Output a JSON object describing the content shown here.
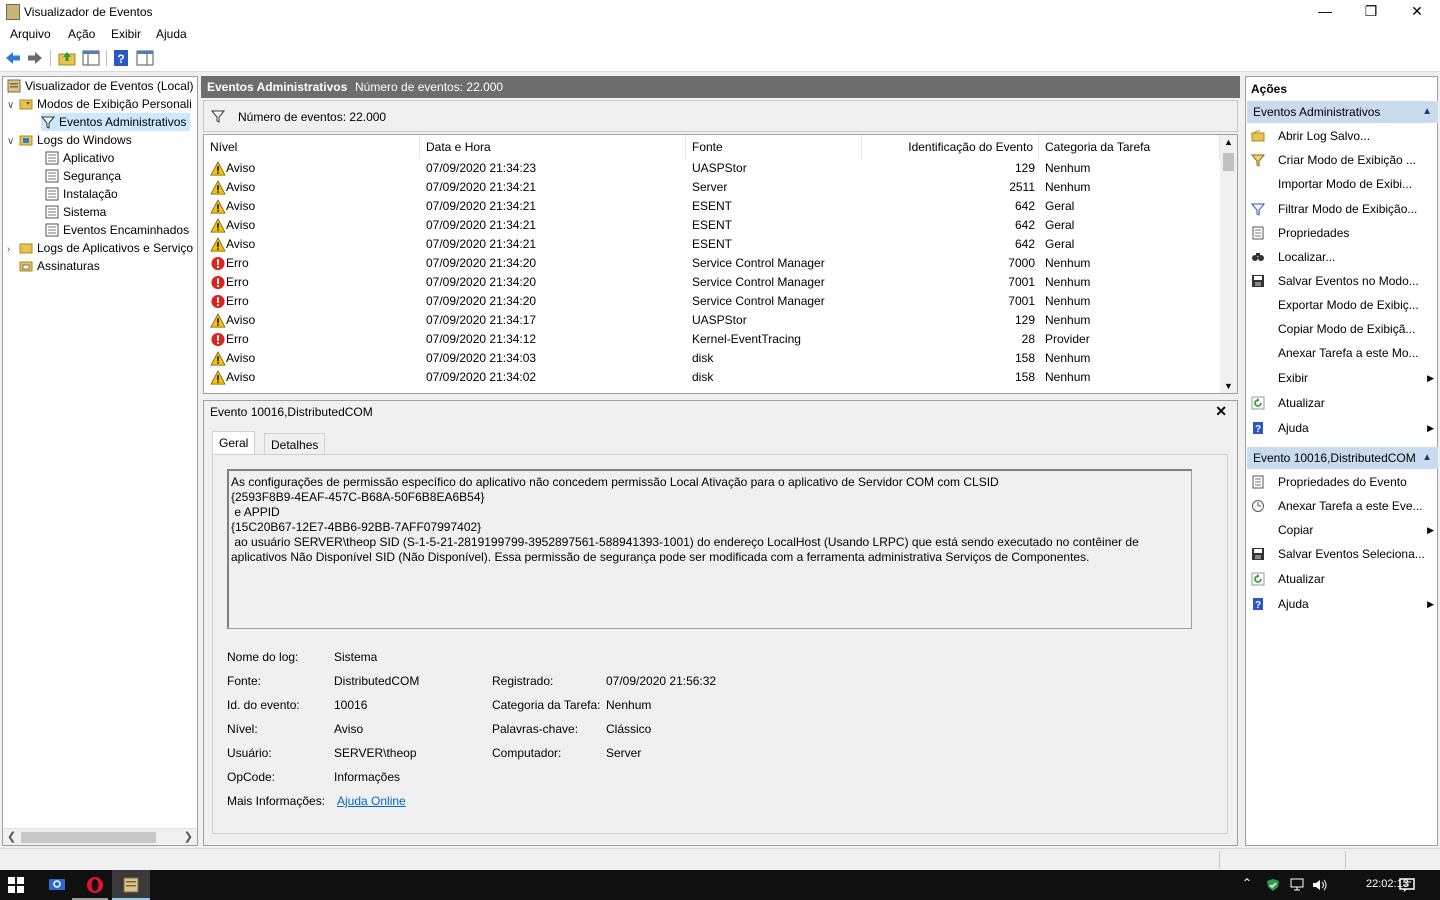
{
  "window": {
    "title": "Visualizador de Eventos"
  },
  "menu": [
    "Arquivo",
    "Ação",
    "Exibir",
    "Ajuda"
  ],
  "tree": {
    "root": "Visualizador de Eventos (Local)",
    "custom_views": "Modos de Exibição Personali",
    "admin_events": "Eventos Administrativos",
    "windows_logs": "Logs do Windows",
    "app": "Aplicativo",
    "security": "Segurança",
    "setup": "Instalação",
    "system": "Sistema",
    "forwarded": "Eventos Encaminhados",
    "app_services": "Logs de Aplicativos e Serviço",
    "subscriptions": "Assinaturas"
  },
  "center": {
    "title": "Eventos Administrativos",
    "count": "Número de eventos: 22.000",
    "filter_text": "Número de eventos: 22.000"
  },
  "columns": {
    "level": "Nível",
    "date": "Data e Hora",
    "source": "Fonte",
    "id": "Identificação do Evento",
    "category": "Categoria da Tarefa"
  },
  "events": [
    {
      "level": "Aviso",
      "type": "warning",
      "date": "07/09/2020 21:34:23",
      "source": "UASPStor",
      "id": "129",
      "category": "Nenhum"
    },
    {
      "level": "Aviso",
      "type": "warning",
      "date": "07/09/2020 21:34:21",
      "source": "Server",
      "id": "2511",
      "category": "Nenhum"
    },
    {
      "level": "Aviso",
      "type": "warning",
      "date": "07/09/2020 21:34:21",
      "source": "ESENT",
      "id": "642",
      "category": "Geral"
    },
    {
      "level": "Aviso",
      "type": "warning",
      "date": "07/09/2020 21:34:21",
      "source": "ESENT",
      "id": "642",
      "category": "Geral"
    },
    {
      "level": "Aviso",
      "type": "warning",
      "date": "07/09/2020 21:34:21",
      "source": "ESENT",
      "id": "642",
      "category": "Geral"
    },
    {
      "level": "Erro",
      "type": "error",
      "date": "07/09/2020 21:34:20",
      "source": "Service Control Manager",
      "id": "7000",
      "category": "Nenhum"
    },
    {
      "level": "Erro",
      "type": "error",
      "date": "07/09/2020 21:34:20",
      "source": "Service Control Manager",
      "id": "7001",
      "category": "Nenhum"
    },
    {
      "level": "Erro",
      "type": "error",
      "date": "07/09/2020 21:34:20",
      "source": "Service Control Manager",
      "id": "7001",
      "category": "Nenhum"
    },
    {
      "level": "Aviso",
      "type": "warning",
      "date": "07/09/2020 21:34:17",
      "source": "UASPStor",
      "id": "129",
      "category": "Nenhum"
    },
    {
      "level": "Erro",
      "type": "error",
      "date": "07/09/2020 21:34:12",
      "source": "Kernel-EventTracing",
      "id": "28",
      "category": "Provider"
    },
    {
      "level": "Aviso",
      "type": "warning",
      "date": "07/09/2020 21:34:03",
      "source": "disk",
      "id": "158",
      "category": "Nenhum"
    },
    {
      "level": "Aviso",
      "type": "warning",
      "date": "07/09/2020 21:34:02",
      "source": "disk",
      "id": "158",
      "category": "Nenhum"
    }
  ],
  "detail": {
    "title": "Evento 10016,DistributedCOM",
    "tab_general": "Geral",
    "tab_details": "Detalhes",
    "description": "As configurações de permissão específico do aplicativo não concedem permissão Local Ativação para o aplicativo de Servidor COM com CLSID\n{2593F8B9-4EAF-457C-B68A-50F6B8EA6B54}\n e APPID\n{15C20B67-12E7-4BB6-92BB-7AFF07997402}\n ao usuário SERVER\\theop SID (S-1-5-21-2819199799-3952897561-588941393-1001) do endereço LocalHost (Usando LRPC) que está sendo executado no contêiner de aplicativos Não Disponível SID (Não Disponível). Essa permissão de segurança pode ser modificada com a ferramenta administrativa Serviços de Componentes.",
    "fields": {
      "log_name_label": "Nome do log:",
      "log_name": "Sistema",
      "source_label": "Fonte:",
      "source": "DistributedCOM",
      "logged_label": "Registrado:",
      "logged": "07/09/2020 21:56:32",
      "event_id_label": "Id. do evento:",
      "event_id": "10016",
      "task_cat_label": "Categoria da Tarefa:",
      "task_cat": "Nenhum",
      "level_label": "Nível:",
      "level": "Aviso",
      "keywords_label": "Palavras-chave:",
      "keywords": "Clássico",
      "user_label": "Usuário:",
      "user": "SERVER\\theop",
      "computer_label": "Computador:",
      "computer": "Server",
      "opcode_label": "OpCode:",
      "opcode": "Informações",
      "more_info_label": "Mais Informações:",
      "more_info": "Ajuda Online"
    }
  },
  "actions": {
    "header": "Ações",
    "section1": "Eventos Administrativos",
    "items1": [
      "Abrir Log Salvo...",
      "Criar Modo de Exibição ...",
      "Importar Modo de Exibi...",
      "Filtrar Modo de Exibição...",
      "Propriedades",
      "Localizar...",
      "Salvar Eventos no Modo...",
      "Exportar Modo de Exibiç...",
      "Copiar Modo de Exibiçã...",
      "Anexar Tarefa a este Mo...",
      "Exibir",
      "Atualizar",
      "Ajuda"
    ],
    "section2": "Evento 10016,DistributedCOM",
    "items2": [
      "Propriedades do Evento",
      "Anexar Tarefa a este Eve...",
      "Copiar",
      "Salvar Eventos Seleciona...",
      "Atualizar",
      "Ajuda"
    ]
  },
  "taskbar": {
    "clock": "22:02:13"
  }
}
